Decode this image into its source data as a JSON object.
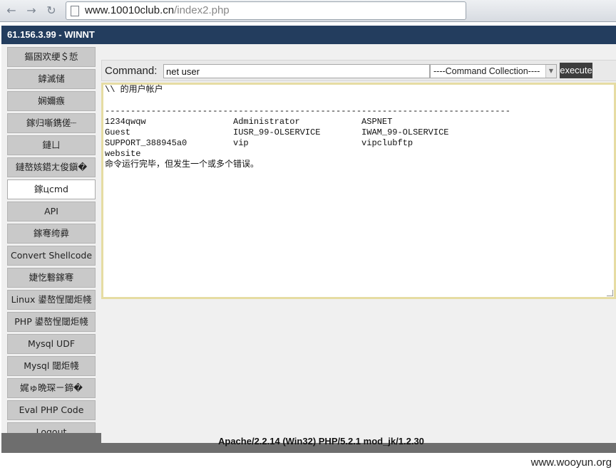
{
  "browser": {
    "back_glyph": "←",
    "forward_glyph": "→",
    "reload_glyph": "↻",
    "url_domain": "www.10010club.cn",
    "url_path": "/index2.php"
  },
  "header": {
    "title": "61.156.3.99 - WINNT"
  },
  "sidebar": {
    "items": [
      {
        "label": "鏂囦欢绠＄悊"
      },
      {
        "label": "鎼滅储"
      },
      {
        "label": "娴嬭瘯"
      },
      {
        "label": "鎵归噺鎸傞┈"
      },
      {
        "label": "鏈ㄩ"
      },
      {
        "label": "鏈嶅姟鍣ㄤ俊鎭�"
      },
      {
        "label": "鎵цcmd"
      },
      {
        "label": "API"
      },
      {
        "label": "鎵弿绔彛"
      },
      {
        "label": "Convert Shellcode"
      },
      {
        "label": "婕忔礊鎵弿"
      },
      {
        "label": "Linux 鍙嶅悜閾炬帴"
      },
      {
        "label": "PHP 鍙嶅悜閾炬帴"
      },
      {
        "label": "Mysql UDF"
      },
      {
        "label": "Mysql 閾炬帴"
      },
      {
        "label": "娓ゅ晩琛ㄧ鍗�"
      },
      {
        "label": "Eval PHP Code"
      },
      {
        "label": "Logout"
      }
    ],
    "active_index": 6
  },
  "command": {
    "label": "Command:",
    "value": "net user",
    "collection_selected": "----Command Collection----",
    "execute_label": "execute"
  },
  "output": {
    "text": "\\\\ 的用户帐户\n\n-------------------------------------------------------------------------------\n1234qwqw                 Administrator            ASPNET\nGuest                    IUSR_99-OLSERVICE        IWAM_99-OLSERVICE\nSUPPORT_388945a0         vip                      vipclubftp\nwebsite\n命令运行完毕，但发生一个或多个错误。"
  },
  "footer": {
    "text": "Apache/2.2.14 (Win32) PHP/5.2.1 mod_jk/1.2.30"
  },
  "watermark": "www.wooyun.org",
  "colors": {
    "header_bg": "#233d5e",
    "execute_bg": "#3d3d3d",
    "output_border": "#e6dca3"
  }
}
